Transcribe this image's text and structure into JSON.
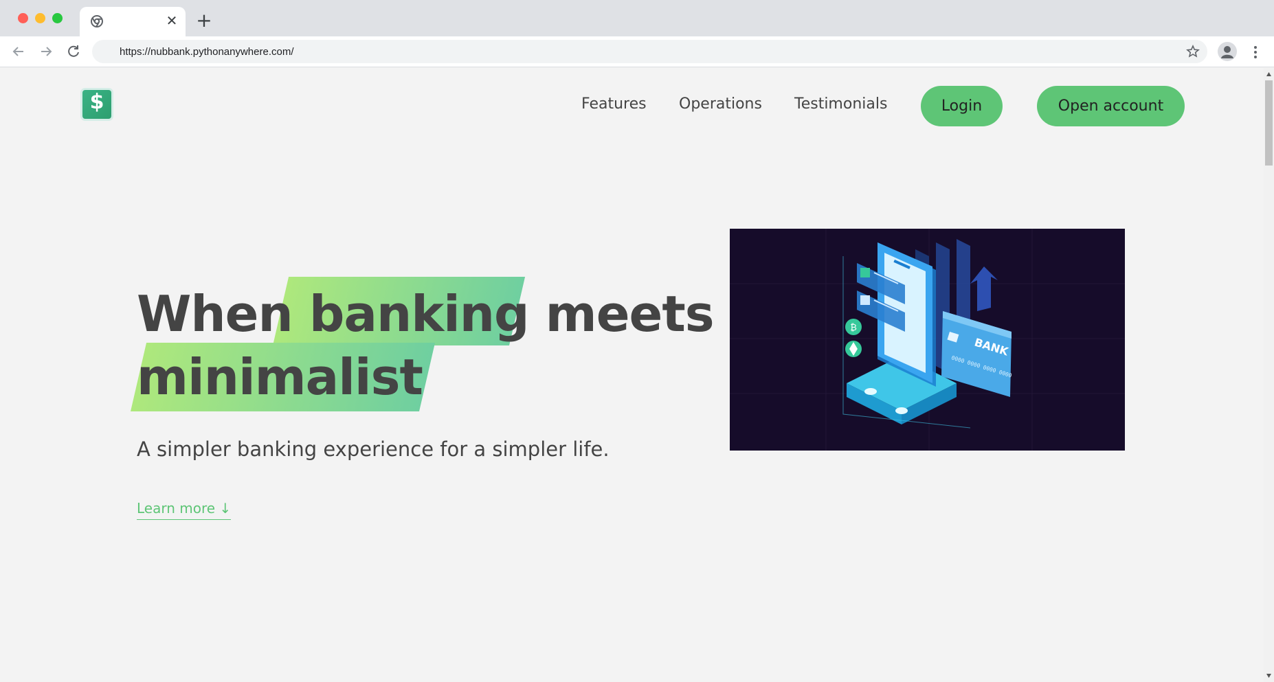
{
  "browser": {
    "url": "https://nubbank.pythonanywhere.com/",
    "tab_close_glyph": "✕",
    "new_tab_glyph": "+"
  },
  "nav": {
    "logo_glyph": "$",
    "links": [
      "Features",
      "Operations",
      "Testimonials"
    ],
    "login_label": "Login",
    "open_account_label": "Open account"
  },
  "hero": {
    "title_line1": [
      "When",
      "banking",
      "meets"
    ],
    "title_line2": "minimalist",
    "subtitle": "A simpler banking experience for a simpler life.",
    "learn_more": "Learn more ↓",
    "image_card_text": "BANK",
    "image_digits": "0000 0000 0000 0000"
  },
  "colors": {
    "accent": "#5ec576",
    "highlight_start": "#aee87c",
    "highlight_end": "#6fcfa0",
    "text": "#444444",
    "image_bg": "#160c2a"
  },
  "icons": [
    "chrome-favicon-icon",
    "close-icon",
    "plus-icon",
    "back-arrow-icon",
    "forward-arrow-icon",
    "reload-icon",
    "star-icon",
    "profile-icon",
    "menu-dots-icon",
    "dollar-logo-icon"
  ]
}
